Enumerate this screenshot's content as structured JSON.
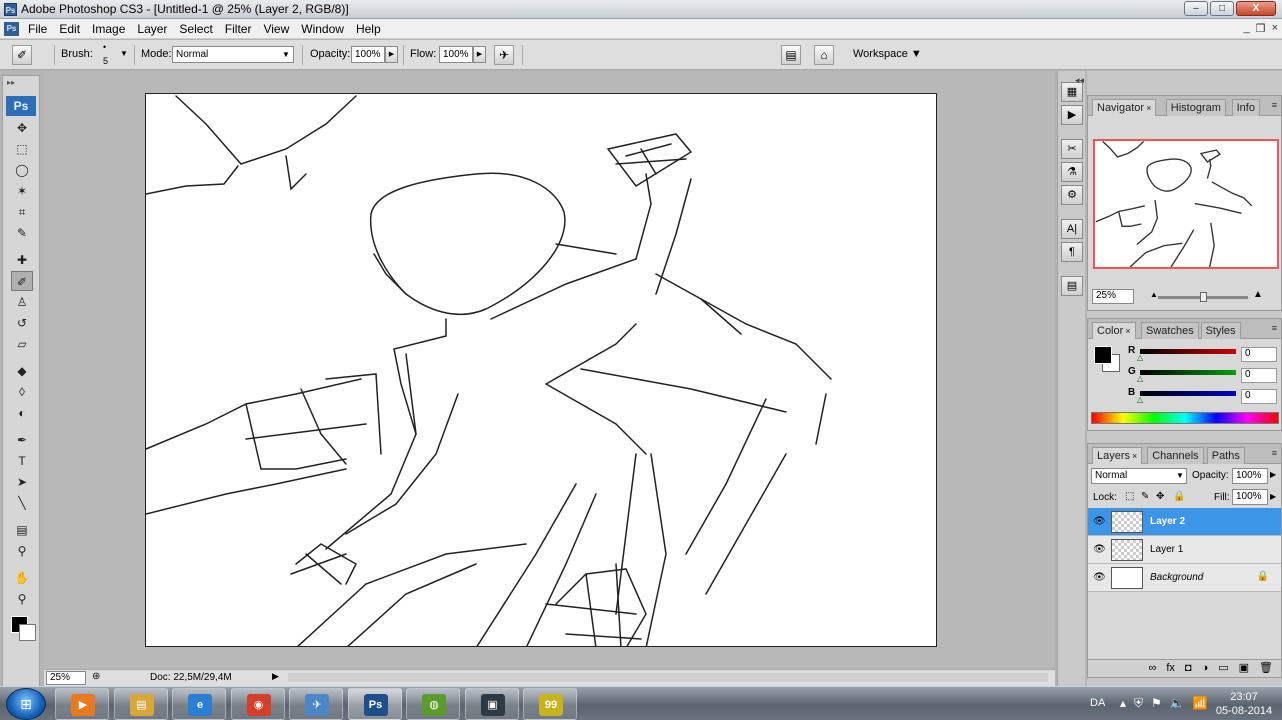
{
  "window": {
    "app_icon": "Ps",
    "title": "Adobe Photoshop CS3 - [Untitled-1 @ 25% (Layer 2, RGB/8)]",
    "minimize_glyph": "–",
    "maximize_glyph": "□",
    "close_glyph": "X"
  },
  "menu": {
    "app_icon": "Ps",
    "items": [
      "File",
      "Edit",
      "Image",
      "Layer",
      "Select",
      "Filter",
      "View",
      "Window",
      "Help"
    ],
    "doc_buttons": [
      "_",
      "❐",
      "×"
    ]
  },
  "options": {
    "brush_label": "Brush:",
    "brush_size": "5",
    "mode_label": "Mode:",
    "mode_value": "Normal",
    "opacity_label": "Opacity:",
    "opacity_value": "100%",
    "flow_label": "Flow:",
    "flow_value": "100%",
    "workspace_label": "Workspace ▼"
  },
  "tools": {
    "logo": "Ps",
    "items": [
      {
        "name": "move-tool-icon",
        "glyph": "✥"
      },
      {
        "name": "marquee-tool-icon",
        "glyph": "⬚"
      },
      {
        "name": "lasso-tool-icon",
        "glyph": "◯"
      },
      {
        "name": "magic-wand-tool-icon",
        "glyph": "✶"
      },
      {
        "name": "crop-tool-icon",
        "glyph": "⌗"
      },
      {
        "name": "slice-tool-icon",
        "glyph": "✎"
      },
      {
        "name": "healing-brush-tool-icon",
        "glyph": "✚"
      },
      {
        "name": "brush-tool-icon",
        "glyph": "✐"
      },
      {
        "name": "clone-stamp-tool-icon",
        "glyph": "♙"
      },
      {
        "name": "history-brush-tool-icon",
        "glyph": "↺"
      },
      {
        "name": "eraser-tool-icon",
        "glyph": "▱"
      },
      {
        "name": "paint-bucket-tool-icon",
        "glyph": "◆"
      },
      {
        "name": "blur-tool-icon",
        "glyph": "◊"
      },
      {
        "name": "dodge-tool-icon",
        "glyph": "◐"
      },
      {
        "name": "pen-tool-icon",
        "glyph": "✒"
      },
      {
        "name": "type-tool-icon",
        "glyph": "T"
      },
      {
        "name": "path-selection-tool-icon",
        "glyph": "➤"
      },
      {
        "name": "line-tool-icon",
        "glyph": "╲"
      },
      {
        "name": "notes-tool-icon",
        "glyph": "▤"
      },
      {
        "name": "eyedropper-tool-icon",
        "glyph": "⚲"
      },
      {
        "name": "hand-tool-icon",
        "glyph": "✋"
      },
      {
        "name": "zoom-tool-icon",
        "glyph": "⚲"
      }
    ]
  },
  "status": {
    "zoom": "25%",
    "doc": "Doc: 22,5M/29,4M",
    "arrow": "▶"
  },
  "dock": {
    "icons": [
      "▦",
      "▶",
      "✂",
      "⚗",
      "⚙",
      "A|",
      "¶",
      "▤"
    ]
  },
  "navigator": {
    "tabs": [
      {
        "label": "Navigator",
        "close": "×"
      },
      {
        "label": "Histogram",
        "close": ""
      },
      {
        "label": "Info",
        "close": ""
      }
    ],
    "zoom": "25%",
    "zoom_fraction": 0.5
  },
  "color": {
    "tabs": [
      {
        "label": "Color",
        "close": "×"
      },
      {
        "label": "Swatches",
        "close": ""
      },
      {
        "label": "Styles",
        "close": ""
      }
    ],
    "channels": [
      {
        "label": "R",
        "value": "0",
        "color": "#cc0000"
      },
      {
        "label": "G",
        "value": "0",
        "color": "#00a000"
      },
      {
        "label": "B",
        "value": "0",
        "color": "#0000c0"
      }
    ]
  },
  "layers": {
    "tabs": [
      {
        "label": "Layers",
        "close": "×"
      },
      {
        "label": "Channels",
        "close": ""
      },
      {
        "label": "Paths",
        "close": ""
      }
    ],
    "blend_mode": "Normal",
    "opacity_label": "Opacity:",
    "opacity_value": "100%",
    "lock_label": "Lock:",
    "fill_label": "Fill:",
    "fill_value": "100%",
    "items": [
      {
        "name": "Layer 2",
        "selected": true
      },
      {
        "name": "Layer 1",
        "selected": false
      },
      {
        "name": "Background",
        "selected": false,
        "locked": true
      }
    ],
    "footer_icons": [
      "∞",
      "fx",
      "◘",
      "◑",
      "▭",
      "▣",
      "🗑"
    ]
  },
  "taskbar": {
    "start_glyph": "⊞",
    "apps": [
      {
        "name": "media-player-app",
        "glyph": "▶",
        "color": "#e87a1e"
      },
      {
        "name": "explorer-app",
        "glyph": "▤",
        "color": "#d9a63c"
      },
      {
        "name": "internet-explorer-app",
        "glyph": "e",
        "color": "#2a7fd4"
      },
      {
        "name": "chrome-app",
        "glyph": "◉",
        "color": "#d43f2a"
      },
      {
        "name": "utility-app",
        "glyph": "✈",
        "color": "#4b86c6"
      },
      {
        "name": "photoshop-app",
        "glyph": "Ps",
        "color": "#1e4f8a",
        "active": true
      },
      {
        "name": "game-app",
        "glyph": "◍",
        "color": "#5b9b2e"
      },
      {
        "name": "terminal-app",
        "glyph": "▣",
        "color": "#2d3a44"
      },
      {
        "name": "fraps-app",
        "glyph": "99",
        "color": "#c8b21e"
      }
    ],
    "lang": "DA",
    "time": "23:07",
    "date": "05-08-2014"
  }
}
